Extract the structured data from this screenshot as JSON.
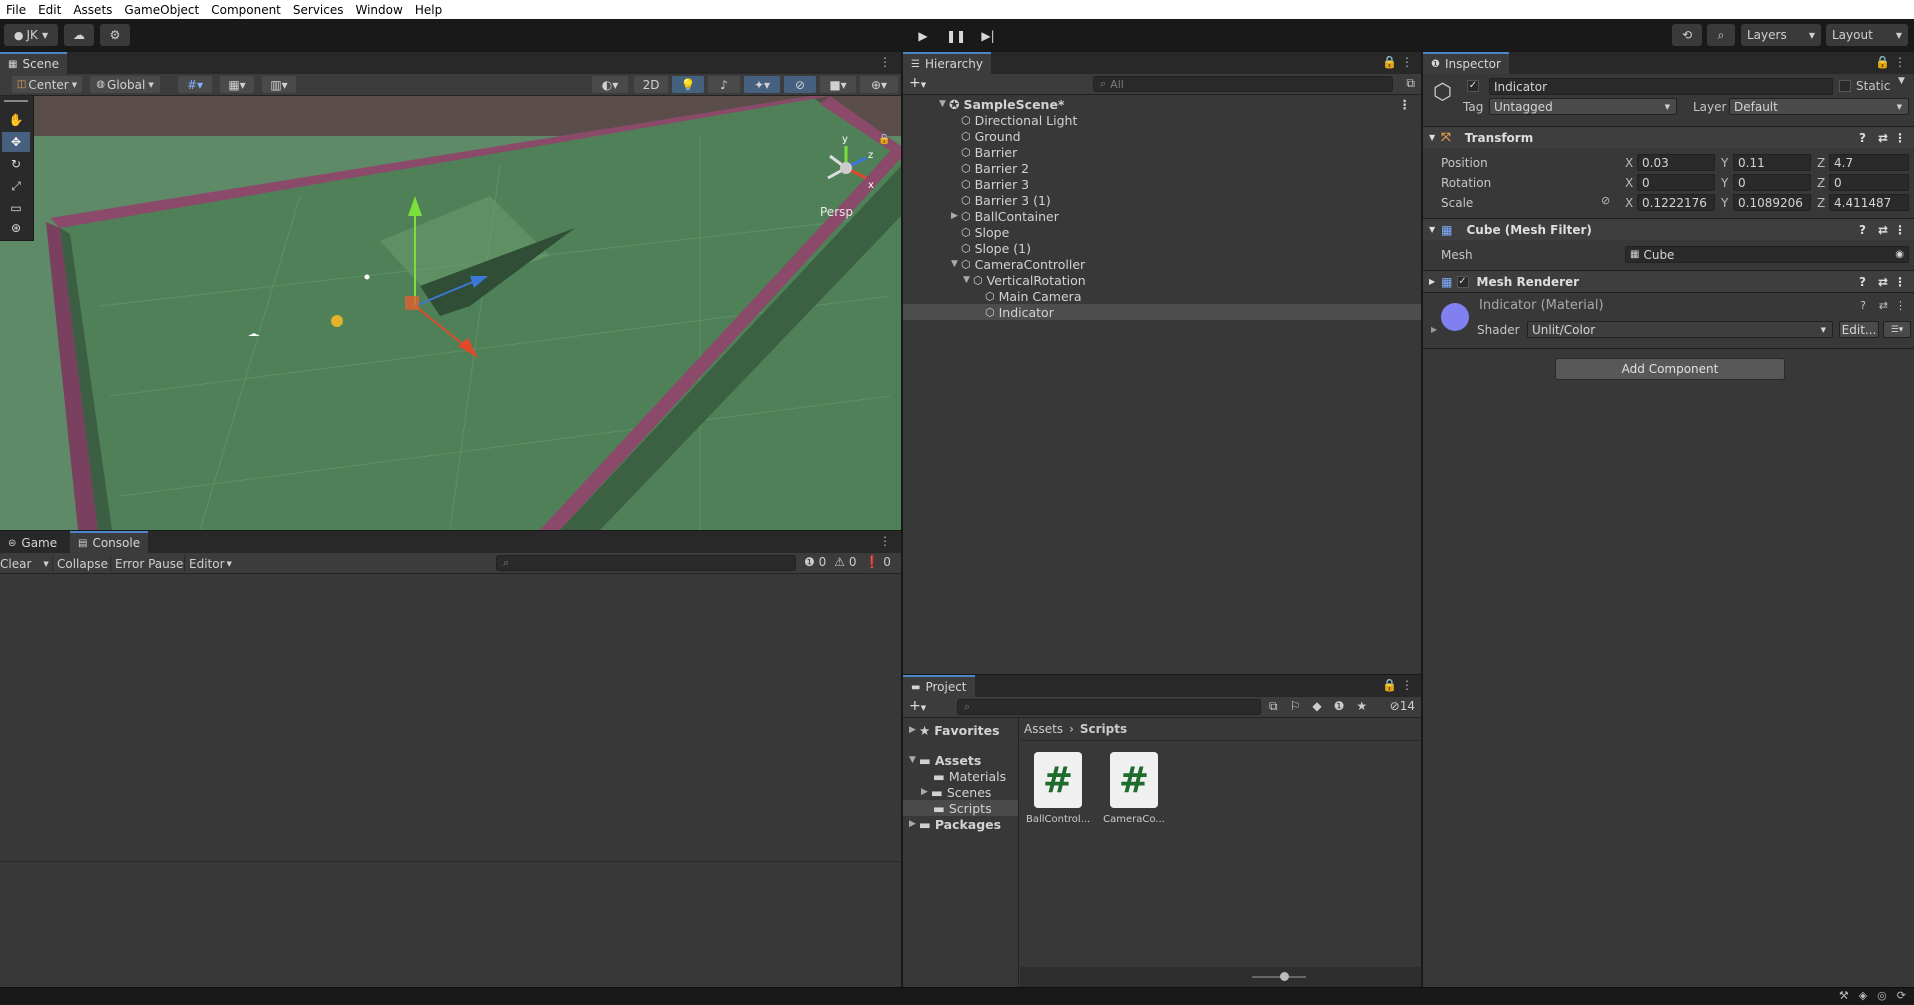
{
  "menu": [
    "File",
    "Edit",
    "Assets",
    "GameObject",
    "Component",
    "Services",
    "Window",
    "Help"
  ],
  "toolbar": {
    "account": "JK",
    "layers": "Layers",
    "layout": "Layout"
  },
  "scene": {
    "tab": "Scene",
    "pivot": "Center",
    "space": "Global",
    "mode2d": "2D",
    "persp": "Persp",
    "gizmo_y": "y",
    "gizmo_z": "z",
    "gizmo_x": "x"
  },
  "console": {
    "tab_game": "Game",
    "tab_console": "Console",
    "clear": "Clear",
    "collapse": "Collapse",
    "error_pause": "Error Pause",
    "editor": "Editor",
    "count_log": "0",
    "count_warn": "0",
    "count_err": "0"
  },
  "hierarchy": {
    "tab": "Hierarchy",
    "search_placeholder": "All",
    "scene_name": "SampleScene*",
    "items": [
      {
        "label": "Directional Light",
        "depth": 1,
        "expander": ""
      },
      {
        "label": "Ground",
        "depth": 1,
        "expander": ""
      },
      {
        "label": "Barrier",
        "depth": 1,
        "expander": ""
      },
      {
        "label": "Barrier 2",
        "depth": 1,
        "expander": ""
      },
      {
        "label": "Barrier 3",
        "depth": 1,
        "expander": ""
      },
      {
        "label": "Barrier 3 (1)",
        "depth": 1,
        "expander": ""
      },
      {
        "label": "BallContainer",
        "depth": 1,
        "expander": "▶"
      },
      {
        "label": "Slope",
        "depth": 1,
        "expander": ""
      },
      {
        "label": "Slope (1)",
        "depth": 1,
        "expander": ""
      },
      {
        "label": "CameraController",
        "depth": 1,
        "expander": "▼"
      },
      {
        "label": "VerticalRotation",
        "depth": 2,
        "expander": "▼"
      },
      {
        "label": "Main Camera",
        "depth": 3,
        "expander": ""
      },
      {
        "label": "Indicator",
        "depth": 3,
        "expander": "",
        "selected": true
      }
    ]
  },
  "project": {
    "tab": "Project",
    "count": "14",
    "favorites": "Favorites",
    "assets": "Assets",
    "folders": [
      "Materials",
      "Scenes",
      "Scripts"
    ],
    "packages": "Packages",
    "breadcrumb": [
      "Assets",
      "Scripts"
    ],
    "files": [
      "BallControl...",
      "CameraCo..."
    ]
  },
  "inspector": {
    "tab": "Inspector",
    "object_name": "Indicator",
    "static_label": "Static",
    "tag_label": "Tag",
    "tag_value": "Untagged",
    "layer_label": "Layer",
    "layer_value": "Default",
    "transform": {
      "title": "Transform",
      "position_label": "Position",
      "rotation_label": "Rotation",
      "scale_label": "Scale",
      "position": {
        "x": "0.03",
        "y": "0.11",
        "z": "4.7"
      },
      "rotation": {
        "x": "0",
        "y": "0",
        "z": "0"
      },
      "scale": {
        "x": "0.1222176",
        "y": "0.1089206",
        "z": "4.411487"
      }
    },
    "mesh_filter": {
      "title": "Cube (Mesh Filter)",
      "mesh_label": "Mesh",
      "mesh_value": "Cube"
    },
    "mesh_renderer": {
      "title": "Mesh Renderer"
    },
    "material": {
      "name": "Indicator (Material)",
      "shader_label": "Shader",
      "shader_value": "Unlit/Color",
      "edit": "Edit...",
      "color": "#8080f0"
    },
    "add_component": "Add Component"
  }
}
